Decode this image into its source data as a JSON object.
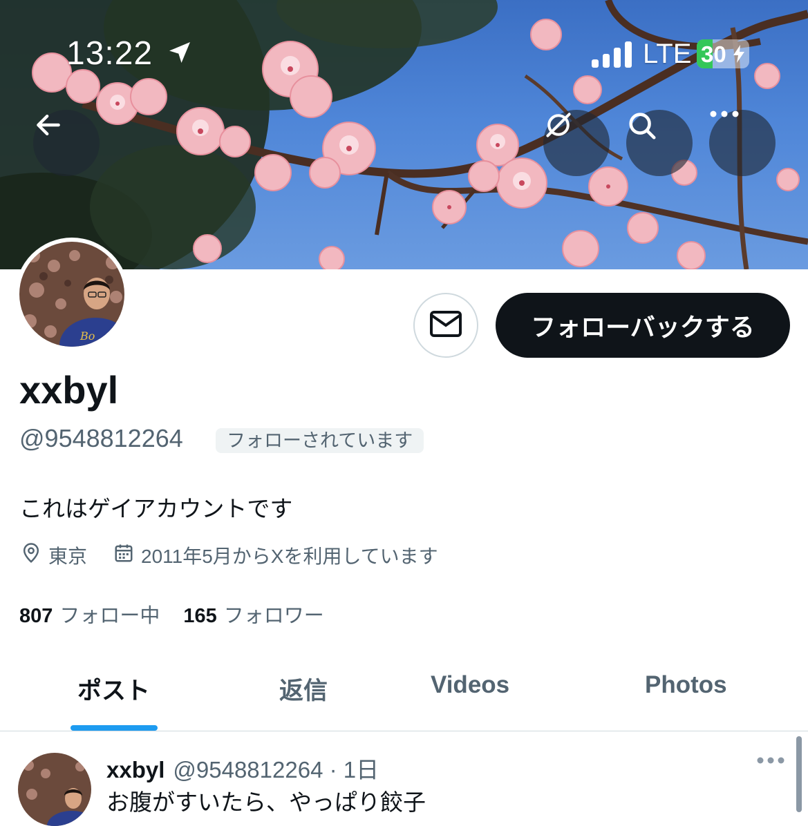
{
  "status_bar": {
    "time": "13:22",
    "network": "LTE",
    "battery": "30",
    "battery_level": 0.3,
    "icons": [
      "location-arrow-icon",
      "signal-bars-icon",
      "battery-charging-icon"
    ]
  },
  "banner_buttons": [
    "back-arrow-icon",
    "hide-reposts-icon",
    "search-icon",
    "more-dots-icon"
  ],
  "profile": {
    "display_name": "xxbyl",
    "handle": "@9548812264",
    "follows_you_badge": "フォローされています",
    "bio": "これはゲイアカウントです",
    "location": "東京",
    "joined": "2011年5月からXを利用しています",
    "following_count": "807",
    "following_label": "フォロー中",
    "followers_count": "165",
    "followers_label": "フォロワー"
  },
  "actions": {
    "follow_back_label": "フォローバックする",
    "dm_icon": "envelope-icon"
  },
  "tabs": [
    {
      "label": "ポスト",
      "active": true
    },
    {
      "label": "返信",
      "active": false
    },
    {
      "label": "Videos",
      "active": false
    },
    {
      "label": "Photos",
      "active": false
    }
  ],
  "post": {
    "author_name": "xxbyl",
    "author_meta": "@9548812264 · 1日",
    "text": "お腹がすいたら、やっぱり餃子"
  },
  "colors": {
    "accent": "#1d9bf0",
    "text_primary": "#0f1419",
    "text_secondary": "#536471",
    "button_dark": "#0f1419"
  }
}
